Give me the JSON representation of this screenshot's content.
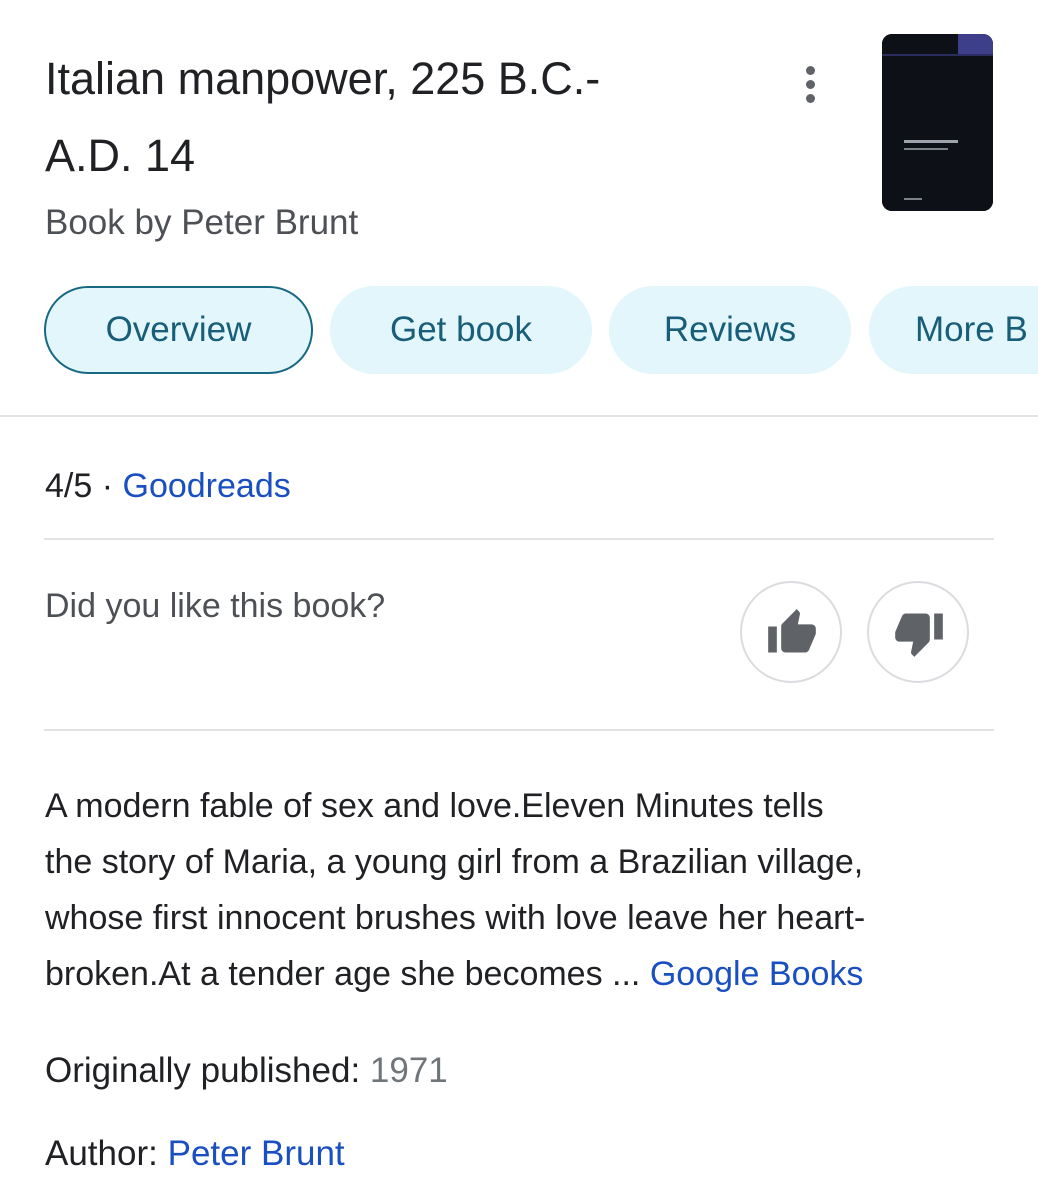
{
  "book": {
    "title_line1": "Italian manpower, 225 B.C.-",
    "title_line2": "A.D. 14",
    "subtitle": "Book by Peter Brunt",
    "cover_icon": "book-cover-thumbnail"
  },
  "tabs": [
    {
      "label": "Overview",
      "active": true
    },
    {
      "label": "Get book",
      "active": false
    },
    {
      "label": "Reviews",
      "active": false
    },
    {
      "label": "More B",
      "active": false
    }
  ],
  "rating": {
    "score": "4/5",
    "separator": "·",
    "source": "Goodreads"
  },
  "feedback": {
    "question": "Did you like this book?",
    "like_icon": "thumbs-up-icon",
    "dislike_icon": "thumbs-down-icon"
  },
  "description": {
    "line1": "A modern fable of sex and love.Eleven Minutes tells",
    "line2": "the story of Maria, a young girl from a Brazilian village,",
    "line3": "whose first innocent brushes with love leave her heart-",
    "line4": "broken.At a tender age she becomes ...",
    "source_link": "Google Books"
  },
  "facts": {
    "published_label": "Originally published:",
    "published_value": "1971",
    "author_label": "Author:",
    "author_value": "Peter Brunt"
  },
  "colors": {
    "link": "#1a4fc1",
    "chip_bg": "#e3f6fb",
    "chip_text": "#185e79",
    "chip_active_border": "#186883",
    "divider": "#e3e3e3",
    "icon_gray": "#5f6368"
  }
}
